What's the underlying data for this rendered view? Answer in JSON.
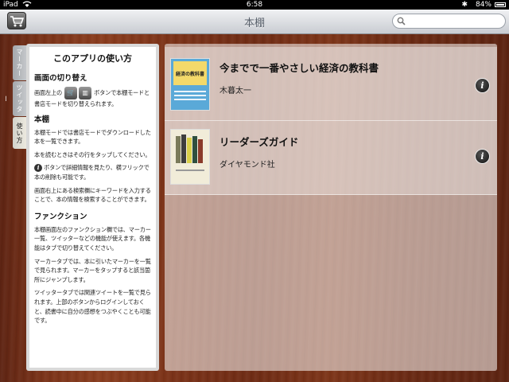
{
  "status_bar": {
    "device": "iPad",
    "time": "6:58",
    "battery": "84%",
    "icons": [
      "wifi-icon",
      "bluetooth-icon",
      "battery-icon"
    ]
  },
  "nav": {
    "title": "本棚",
    "store_button_icon": "shopping-cart-icon",
    "search_icon": "magnifier-icon",
    "search_value": ""
  },
  "side_tabs": [
    {
      "label": "マーカー"
    },
    {
      "label": "ツイッター"
    },
    {
      "label": "使い方"
    }
  ],
  "help": {
    "title": "このアプリの使い方",
    "section1": {
      "heading": "画面の切り替え",
      "text_before": "画面左上の",
      "text_after": "ボタンで本棚モードと書店モードを切り替えられます。"
    },
    "section2": {
      "heading": "本棚",
      "p1": "本棚モードでは書店モードでダウンロードした本を一覧できます。",
      "p2": "本を読むときはその行をタップしてください。",
      "p3": "ボタンで詳細情報を見たり、横フリックで本の削除も可能です。",
      "p4": "画面右上にある検索欄にキーワードを入力することで、本の情報を検索することができます。"
    },
    "section3": {
      "heading": "ファンクション",
      "p1": "本棚画面左のファンクション欄では、マーカー一覧、ツイッターなどの機能が使えます。各機能はタブで切り替えてください。",
      "p2": "マーカータブでは、本に引いたマーカーを一覧で見られます。マーカーをタップすると該当箇所にジャンプします。",
      "p3": "ツイッタータブでは関連ツイートを一覧で見られます。上部のボタンからログインしておくと、読書中に自分の感想をつぶやくことも可能です。"
    }
  },
  "books": [
    {
      "title": "今までで一番やさしい経済の教科書",
      "author": "木暮太一",
      "cover_text": "経済の教科書"
    },
    {
      "title": "リーダーズガイド",
      "author": "ダイヤモンド社"
    }
  ],
  "colors": {
    "wood": "#7a3319",
    "navbar": "#d5d8dd",
    "cover1": "#5aa9d8",
    "cover1_band": "#f3d96a"
  }
}
